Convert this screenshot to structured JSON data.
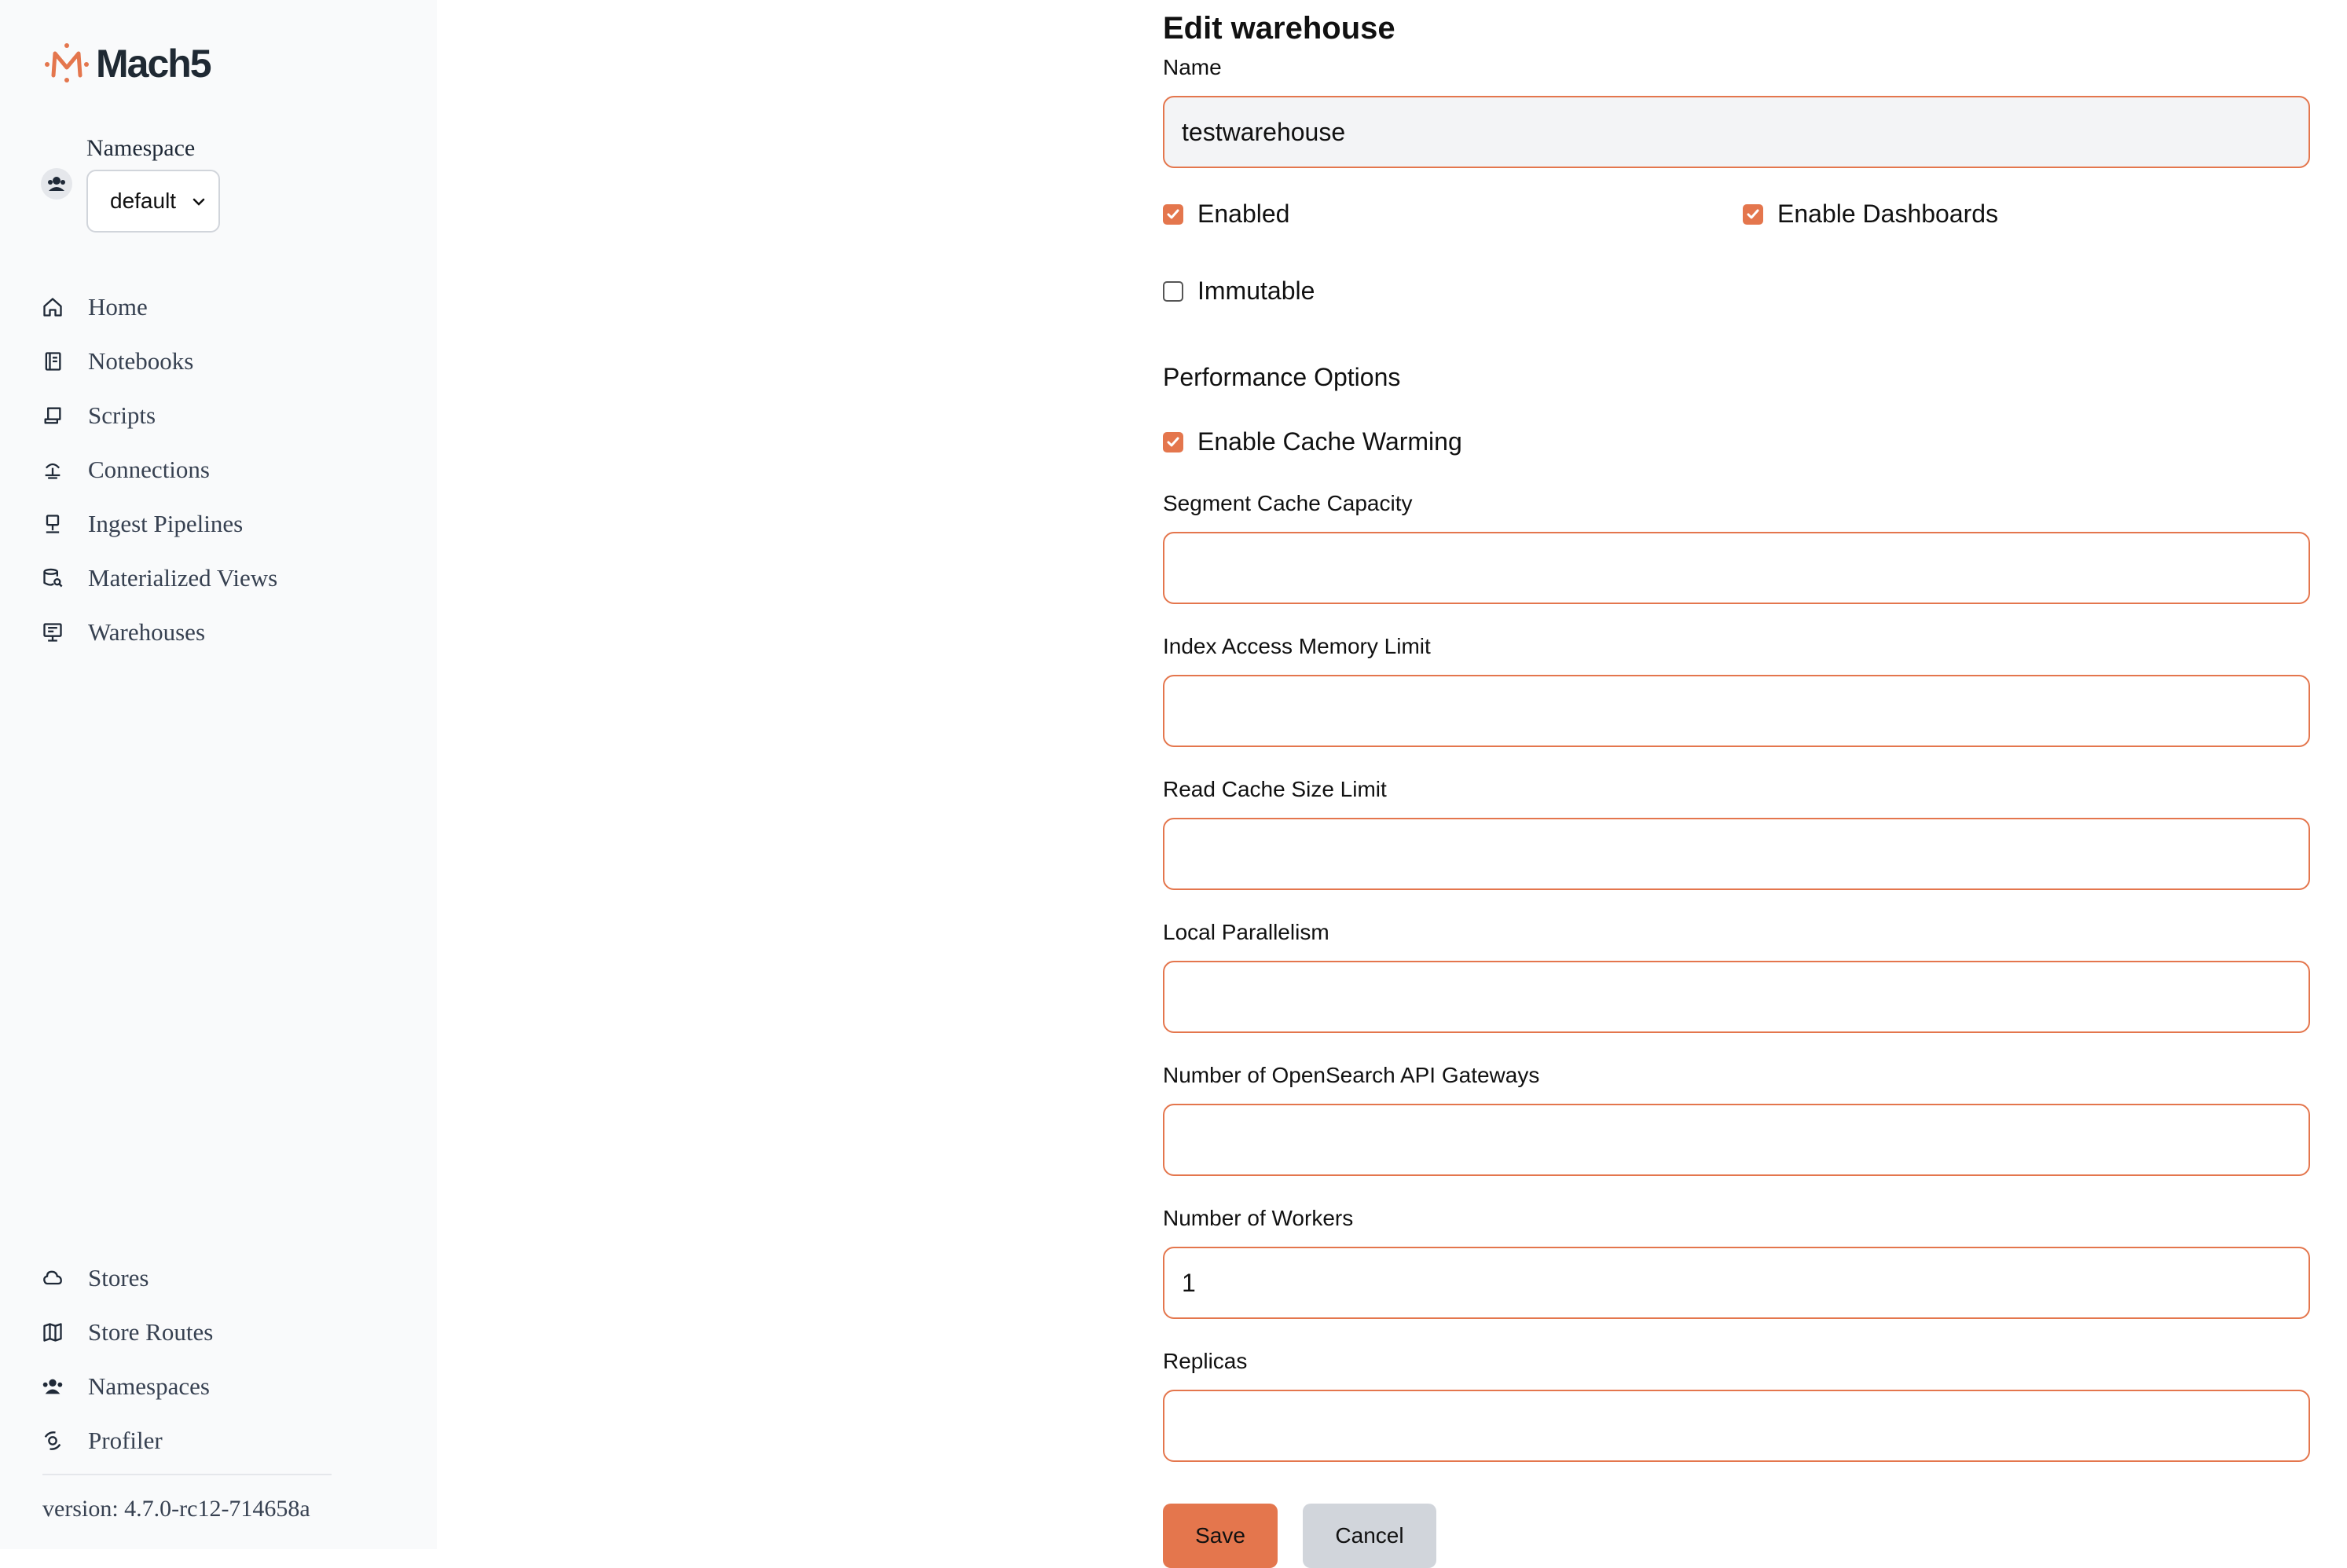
{
  "brand": {
    "name": "Mach5",
    "accent": "#e4764d"
  },
  "namespace": {
    "label": "Namespace",
    "selected": "default"
  },
  "nav_top": [
    {
      "label": "Home",
      "icon": "home-icon"
    },
    {
      "label": "Notebooks",
      "icon": "notebook-icon"
    },
    {
      "label": "Scripts",
      "icon": "script-icon"
    },
    {
      "label": "Connections",
      "icon": "connections-icon"
    },
    {
      "label": "Ingest Pipelines",
      "icon": "pipeline-icon"
    },
    {
      "label": "Materialized Views",
      "icon": "database-search-icon"
    },
    {
      "label": "Warehouses",
      "icon": "warehouse-icon"
    }
  ],
  "nav_bottom": [
    {
      "label": "Stores",
      "icon": "cloud-icon"
    },
    {
      "label": "Store Routes",
      "icon": "map-icon"
    },
    {
      "label": "Namespaces",
      "icon": "users-icon"
    },
    {
      "label": "Profiler",
      "icon": "profiler-icon"
    }
  ],
  "version": "version: 4.7.0-rc12-714658a",
  "form": {
    "title": "Edit warehouse",
    "name_label": "Name",
    "name_value": "testwarehouse",
    "enabled_label": "Enabled",
    "enabled_checked": true,
    "dashboards_label": "Enable Dashboards",
    "dashboards_checked": true,
    "immutable_label": "Immutable",
    "immutable_checked": false,
    "performance_title": "Performance Options",
    "cache_warming_label": "Enable Cache Warming",
    "cache_warming_checked": true,
    "segment_cache_label": "Segment Cache Capacity",
    "segment_cache_value": "",
    "index_memory_label": "Index Access Memory Limit",
    "index_memory_value": "",
    "read_cache_label": "Read Cache Size Limit",
    "read_cache_value": "",
    "local_parallelism_label": "Local Parallelism",
    "local_parallelism_value": "",
    "gateways_label": "Number of OpenSearch API Gateways",
    "gateways_value": "",
    "workers_label": "Number of Workers",
    "workers_value": "1",
    "replicas_label": "Replicas",
    "replicas_value": "",
    "save_label": "Save",
    "cancel_label": "Cancel"
  }
}
